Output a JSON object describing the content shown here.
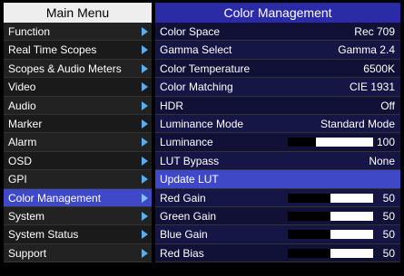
{
  "left": {
    "title": "Main Menu",
    "items": [
      {
        "label": "Function"
      },
      {
        "label": "Real Time Scopes"
      },
      {
        "label": "Scopes & Audio Meters"
      },
      {
        "label": "Video"
      },
      {
        "label": "Audio"
      },
      {
        "label": "Marker"
      },
      {
        "label": "Alarm"
      },
      {
        "label": "OSD"
      },
      {
        "label": "GPI"
      },
      {
        "label": "Color Management"
      },
      {
        "label": "System"
      },
      {
        "label": "System Status"
      },
      {
        "label": "Support"
      }
    ]
  },
  "right": {
    "title": "Color Management",
    "items": [
      {
        "label": "Color Space",
        "value": "Rec 709"
      },
      {
        "label": "Gamma Select",
        "value": "Gamma 2.4"
      },
      {
        "label": "Color Temperature",
        "value": "6500K"
      },
      {
        "label": "Color Matching",
        "value": "CIE 1931"
      },
      {
        "label": "HDR",
        "value": "Off"
      },
      {
        "label": "Luminance Mode",
        "value": "Standard Mode"
      },
      {
        "label": "Luminance",
        "value": "100",
        "level": 0.33
      },
      {
        "label": "LUT Bypass",
        "value": "None"
      },
      {
        "label": "Update LUT",
        "value": ""
      },
      {
        "label": "Red Gain",
        "value": "50",
        "level": 0.5
      },
      {
        "label": "Green Gain",
        "value": "50",
        "level": 0.5
      },
      {
        "label": "Blue Gain",
        "value": "50",
        "level": 0.5
      },
      {
        "label": "Red Bias",
        "value": "50",
        "level": 0.5
      }
    ]
  },
  "colors": {
    "selected_row": "#3f49c8",
    "arrow": "#5aaef0",
    "right_header": "#2b2ba8"
  }
}
